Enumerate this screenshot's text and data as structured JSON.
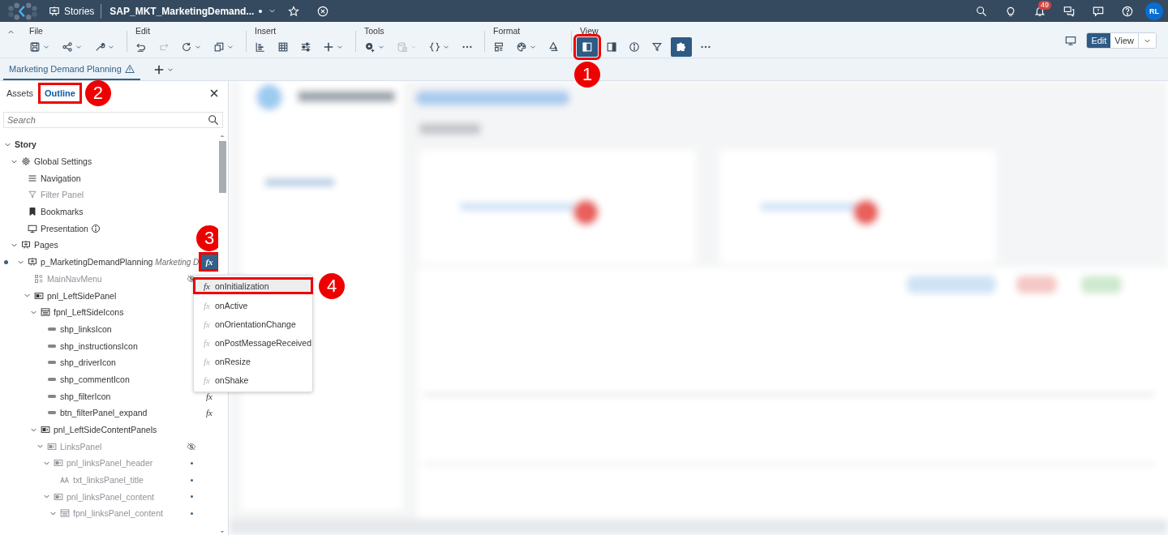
{
  "shell": {
    "app": "Stories",
    "title": "SAP_MKT_MarketingDemand...",
    "unsaved": true,
    "notifications": "49",
    "avatar": "RL"
  },
  "toolbar": {
    "groups": [
      {
        "label": "File",
        "buttons": [
          {
            "kind": "save",
            "caret": true
          },
          {
            "kind": "share",
            "caret": true
          },
          {
            "kind": "wrench",
            "caret": true
          }
        ]
      },
      {
        "label": "Edit",
        "buttons": [
          {
            "kind": "undo",
            "caret": false,
            "disabled": false
          },
          {
            "kind": "redo",
            "caret": false,
            "disabled": true
          },
          {
            "kind": "refresh",
            "caret": true,
            "disabled": false
          },
          {
            "kind": "copy",
            "caret": true,
            "disabled": false
          }
        ]
      },
      {
        "label": "Insert",
        "buttons": [
          {
            "kind": "chart",
            "caret": false
          },
          {
            "kind": "table",
            "caret": false
          },
          {
            "kind": "sliders",
            "caret": false
          },
          {
            "kind": "plus",
            "caret": true
          }
        ]
      },
      {
        "label": "Tools",
        "buttons": [
          {
            "kind": "gear-plus",
            "caret": true,
            "disabled": false
          },
          {
            "kind": "database",
            "caret": true,
            "disabled": true
          },
          {
            "kind": "braces",
            "caret": true,
            "disabled": false
          },
          {
            "kind": "more",
            "caret": false,
            "disabled": false
          }
        ]
      },
      {
        "label": "Format",
        "buttons": [
          {
            "kind": "layout",
            "caret": false
          },
          {
            "kind": "palette",
            "caret": true
          },
          {
            "kind": "paint",
            "caret": false
          }
        ]
      },
      {
        "label": "View",
        "buttons": [
          {
            "kind": "panel-left",
            "caret": false,
            "on": true,
            "callout": "1"
          },
          {
            "kind": "panel-right",
            "caret": false,
            "on": false
          },
          {
            "kind": "info",
            "caret": false,
            "on": false
          },
          {
            "kind": "filter",
            "caret": false,
            "on": false
          },
          {
            "kind": "puzzle",
            "caret": false,
            "on": true
          },
          {
            "kind": "more",
            "caret": false,
            "on": false
          }
        ]
      }
    ],
    "mode": [
      {
        "label": "Edit",
        "selected": true
      },
      {
        "label": "View",
        "selected": false
      }
    ]
  },
  "page_tabs": [
    {
      "label": "Marketing Demand Planning",
      "warning": true,
      "selected": true
    }
  ],
  "panel": {
    "tabs": [
      {
        "label": "Assets",
        "selected": false
      },
      {
        "label": "Outline",
        "selected": true,
        "callout": "2"
      }
    ],
    "search": {
      "placeholder": "Search"
    },
    "tree": [
      {
        "label": "Story",
        "bold": true,
        "expanded": true,
        "children": [
          {
            "label": "Global Settings",
            "kind": "gear",
            "expanded": true,
            "children": [
              {
                "label": "Navigation",
                "kind": "list"
              },
              {
                "label": "Filter Panel",
                "kind": "filter",
                "disabled": true
              },
              {
                "label": "Bookmarks",
                "kind": "bookmark"
              },
              {
                "label": "Presentation",
                "kind": "monitor",
                "info": true
              }
            ]
          },
          {
            "label": "Pages",
            "kind": "page",
            "expanded": true,
            "children": [
              {
                "label": "p_MarketingDemandPlanning",
                "subtitle": "Marketing D",
                "kind": "page",
                "current": true,
                "expanded": true,
                "script": {
                  "symbol": "fx",
                  "callout": "3"
                },
                "children": [
                  {
                    "label": "MainNavMenu",
                    "kind": "widget",
                    "disabled": true,
                    "hidden": true
                  },
                  {
                    "label": "pnl_LeftSidePanel",
                    "kind": "panel",
                    "expanded": true,
                    "children": [
                      {
                        "label": "fpnl_LeftSideIcons",
                        "kind": "flow",
                        "expanded": true,
                        "children": [
                          {
                            "label": "shp_linksIcon",
                            "kind": "shape"
                          },
                          {
                            "label": "shp_instructionsIcon",
                            "kind": "shape"
                          },
                          {
                            "label": "shp_driverIcon",
                            "kind": "shape"
                          },
                          {
                            "label": "shp_commentIcon",
                            "kind": "shape"
                          },
                          {
                            "label": "shp_filterIcon",
                            "kind": "shape",
                            "script": {
                              "symbol": "fx"
                            }
                          },
                          {
                            "label": "btn_filterPanel_expand",
                            "kind": "shape",
                            "script": {
                              "symbol": "fx"
                            }
                          }
                        ]
                      },
                      {
                        "label": "pnl_LeftSideContentPanels",
                        "kind": "panel",
                        "expanded": true,
                        "children": [
                          {
                            "label": "LinksPanel",
                            "kind": "panel",
                            "disabled": true,
                            "hidden": true,
                            "expanded": true,
                            "children": [
                              {
                                "label": "pnl_linksPanel_header",
                                "kind": "panel",
                                "disabled": true,
                                "dot": true,
                                "expanded": true,
                                "children": [
                                  {
                                    "label": "txt_linksPanel_title",
                                    "kind": "text",
                                    "disabled": true,
                                    "dot": true
                                  }
                                ]
                              },
                              {
                                "label": "pnl_linksPanel_content",
                                "kind": "panel",
                                "disabled": true,
                                "dot": true,
                                "expanded": true,
                                "children": [
                                  {
                                    "label": "fpnl_linksPanel_content",
                                    "kind": "flow",
                                    "disabled": true,
                                    "dot": true,
                                    "expanded": true
                                  }
                                ]
                              }
                            ]
                          }
                        ]
                      }
                    ]
                  }
                ]
              }
            ]
          }
        ]
      }
    ]
  },
  "event_menu": {
    "items": [
      {
        "symbol": "fx",
        "label": "onInitialization",
        "selected": true,
        "callout": "4"
      },
      {
        "symbol": "fx",
        "label": "onActive",
        "selected": false
      },
      {
        "symbol": "fx",
        "label": "onOrientationChange",
        "selected": false
      },
      {
        "symbol": "fx",
        "label": "onPostMessageReceived",
        "selected": false
      },
      {
        "symbol": "fx",
        "label": "onResize",
        "selected": false
      },
      {
        "symbol": "fx",
        "label": "onShake",
        "selected": false
      }
    ]
  }
}
